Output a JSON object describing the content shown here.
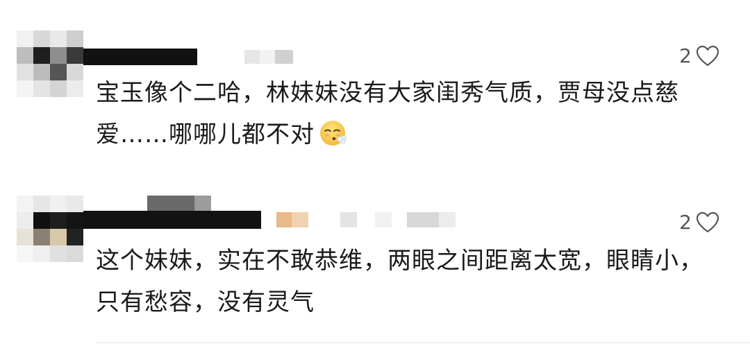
{
  "comments": [
    {
      "text": "宝玉像个二哈，林妹妹没有大家闺秀气质，贾母没点慈爱……哪哪儿都不对",
      "emoji": "face-exhaling-emoji",
      "likes": "2"
    },
    {
      "text": "这个妹妹，实在不敢恭维，两眼之间距离太宽，眼睛小，只有愁容，没有灵气",
      "likes": "2"
    }
  ],
  "colors": {
    "text": "#1a1a1a",
    "like_icon": "#555555",
    "mosaic_dark": "#1c1c1c",
    "mosaic_accent": "#e8b98a"
  }
}
